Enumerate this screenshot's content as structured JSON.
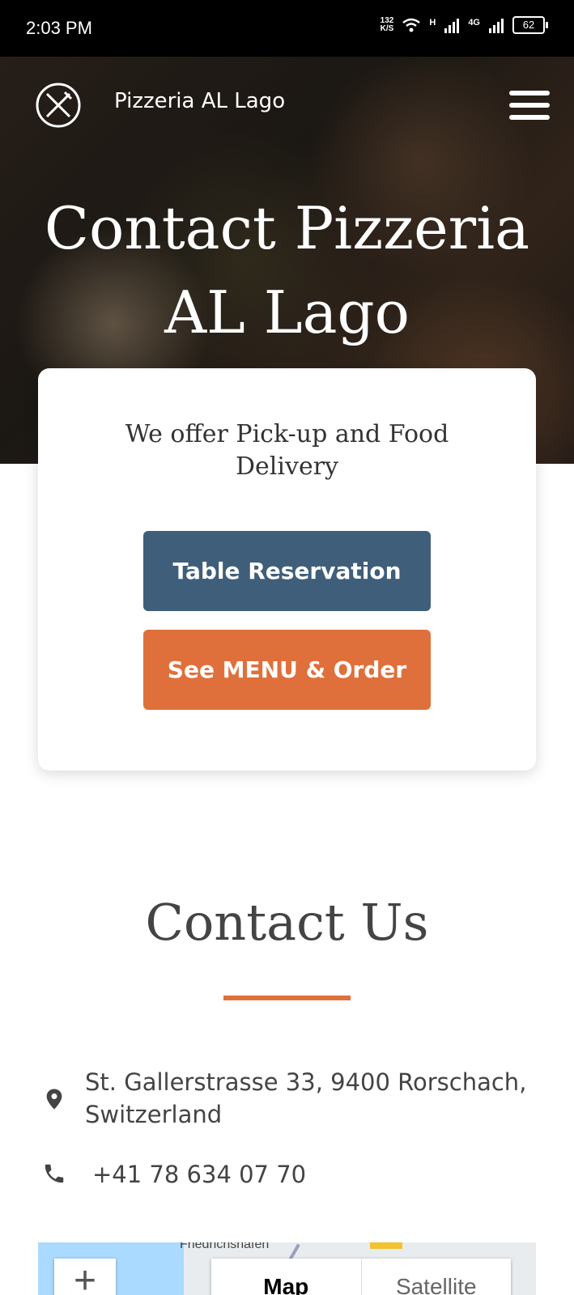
{
  "status_bar": {
    "time": "2:03 PM",
    "net_speed_value": "132",
    "net_speed_unit": "K/S",
    "signal1_label": "H",
    "signal2_label": "4G",
    "battery": "62"
  },
  "header": {
    "brand": "Pizzeria AL Lago",
    "logo_icon": "fork-knife-icon",
    "menu_icon": "hamburger-icon"
  },
  "hero": {
    "title_line1": "Contact Pizzeria",
    "title_line2": "AL Lago"
  },
  "card": {
    "text_line1": "We offer Pick-up and Food",
    "text_line2": "Delivery",
    "reserve_label": "Table Reservation",
    "menu_label": "See MENU & Order",
    "reserve_color": "#3f5e7a",
    "menu_color": "#e0703b"
  },
  "contact": {
    "title": "Contact Us",
    "address_line1": "St. Gallerstrasse 33, 9400 Rorschach,",
    "address_line2": "Switzerland",
    "phone": "+41 78 634 07 70",
    "accent_color": "#e0703b"
  },
  "map": {
    "zoom_in_label": "+",
    "place_label": "Friedrichshafen",
    "map_label": "Map",
    "satellite_label": "Satellite"
  }
}
